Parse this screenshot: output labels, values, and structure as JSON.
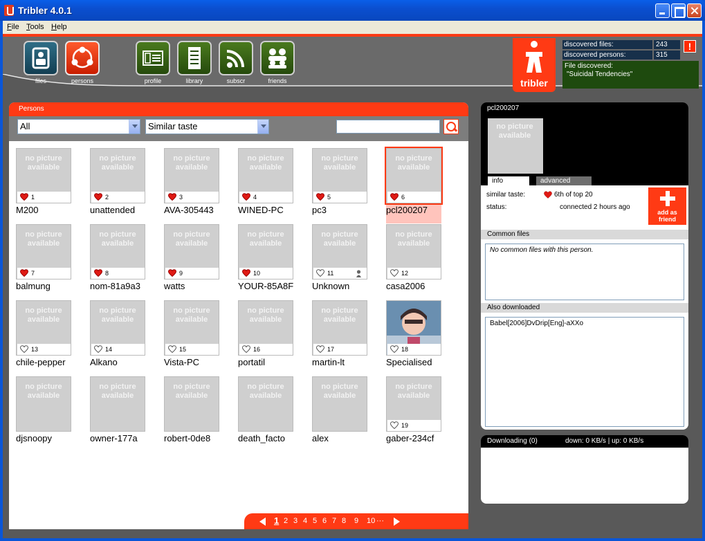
{
  "window": {
    "title": "Tribler 4.0.1"
  },
  "menu": [
    "File",
    "Tools",
    "Help"
  ],
  "toolbar": {
    "buttons": [
      {
        "label": "files",
        "icon": "files-icon"
      },
      {
        "label": "persons",
        "icon": "persons-icon"
      },
      {
        "label": "profile",
        "icon": "profile-icon"
      },
      {
        "label": "library",
        "icon": "library-icon"
      },
      {
        "label": "subscr",
        "icon": "rss-icon"
      },
      {
        "label": "friends",
        "icon": "friends-icon"
      }
    ],
    "active": "persons"
  },
  "logo": {
    "word": "tribler"
  },
  "stats": {
    "discovered_files_label": "discovered files:",
    "discovered_files_value": "243",
    "discovered_persons_label": "discovered persons:",
    "discovered_persons_value": "315",
    "file_discovered_label": "File discovered:",
    "file_discovered_value": "\"Suicidal Tendencies\"",
    "alert": "!"
  },
  "persons": {
    "title": "Persons",
    "filter_select": "All",
    "sort_select": "Similar taste",
    "search_value": "",
    "no_picture_line1": "no picture",
    "no_picture_line2": "available",
    "items": [
      {
        "name": "M200",
        "rank": "1",
        "filled": true
      },
      {
        "name": "unattended",
        "rank": "2",
        "filled": true
      },
      {
        "name": "AVA-305443",
        "rank": "3",
        "filled": true
      },
      {
        "name": "WINED-PC",
        "rank": "4",
        "filled": true
      },
      {
        "name": "pc3",
        "rank": "5",
        "filled": true
      },
      {
        "name": "pcl200207",
        "rank": "6",
        "filled": true,
        "selected": true
      },
      {
        "name": "balmung",
        "rank": "7",
        "filled": true
      },
      {
        "name": "nom-81a9a3",
        "rank": "8",
        "filled": true
      },
      {
        "name": "watts",
        "rank": "9",
        "filled": true
      },
      {
        "name": "YOUR-85A8F",
        "rank": "10",
        "filled": true
      },
      {
        "name": "Unknown",
        "rank": "11",
        "filled": false,
        "online": true
      },
      {
        "name": "casa2006",
        "rank": "12",
        "filled": false
      },
      {
        "name": "chile-pepper",
        "rank": "13",
        "filled": false
      },
      {
        "name": "Alkano",
        "rank": "14",
        "filled": false
      },
      {
        "name": "Vista-PC",
        "rank": "15",
        "filled": false
      },
      {
        "name": "portatil",
        "rank": "16",
        "filled": false
      },
      {
        "name": "martin-lt",
        "rank": "17",
        "filled": false
      },
      {
        "name": "Specialised",
        "rank": "18",
        "filled": false,
        "picture": true
      },
      {
        "name": "djsnoopy",
        "rank": "",
        "filled": false
      },
      {
        "name": "owner-177a",
        "rank": "",
        "filled": false
      },
      {
        "name": "robert-0de8",
        "rank": "",
        "filled": false
      },
      {
        "name": "death_facto",
        "rank": "",
        "filled": false
      },
      {
        "name": "alex",
        "rank": "",
        "filled": false
      },
      {
        "name": "gaber-234cf",
        "rank": "19",
        "filled": false
      }
    ]
  },
  "pager": {
    "pages": [
      "1",
      "2",
      "3",
      "4",
      "5",
      "6",
      "7",
      "8",
      "9",
      "10",
      "···"
    ],
    "current": "1"
  },
  "detail": {
    "name": "pcl200207",
    "tab_info": "info",
    "tab_advanced": "advanced",
    "similar_taste_label": "similar taste:",
    "similar_taste_value": "6th of top 20",
    "status_label": "status:",
    "status_value": "connected  2 hours ago",
    "add_friend_label": "add as friend",
    "common_files_header": "Common files",
    "common_files_text": "No common files with this person.",
    "also_downloaded_header": "Also downloaded",
    "also_downloaded_items": [
      "Babel[2006]DvDrip[Eng]-aXXo"
    ]
  },
  "download": {
    "title": "Downloading (0)",
    "rates": "down: 0 KB/s | up: 0 KB/s"
  },
  "colors": {
    "accent": "#ff3a14",
    "background": "#595959",
    "header": "#6a6a6a"
  }
}
